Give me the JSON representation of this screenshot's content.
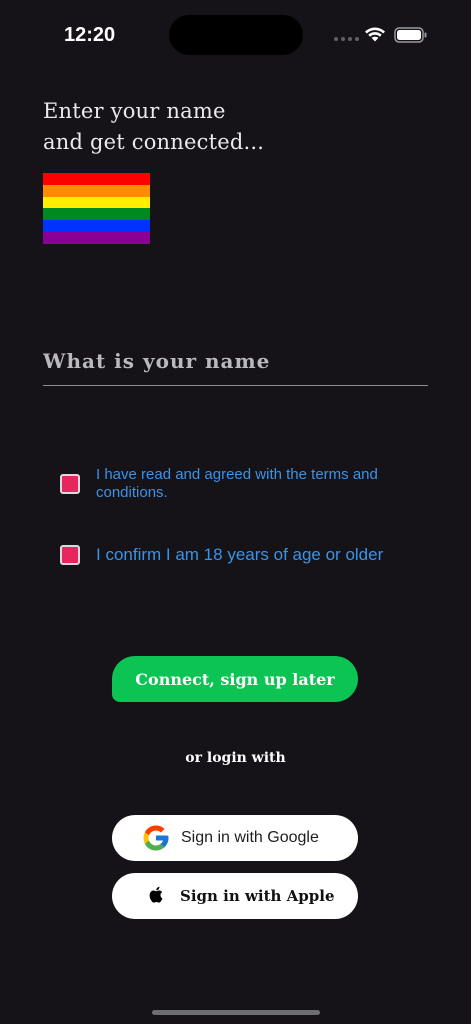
{
  "status_bar": {
    "time": "12:20"
  },
  "header": {
    "line1": "Enter your name",
    "line2": "and get connected..."
  },
  "flag": {
    "icon": "rainbow-flag-icon",
    "stripes": [
      "#ff0000",
      "#ff8c00",
      "#ffee00",
      "#00891f",
      "#0033ff",
      "#8a0096"
    ]
  },
  "name_input": {
    "placeholder": "What is your name",
    "value": ""
  },
  "checkboxes": [
    {
      "label": "I have read and agreed with the terms and conditions.",
      "checked": false,
      "color": "#e6275f"
    },
    {
      "label": "I confirm I am 18 years of age or older",
      "checked": false,
      "color": "#e6275f"
    }
  ],
  "connect_button": {
    "label": "Connect, sign up later",
    "color": "#0bc454"
  },
  "divider_text": "or login with",
  "google_button": {
    "label": "Sign in with Google",
    "icon": "google-icon"
  },
  "apple_button": {
    "label": "Sign in with Apple",
    "icon": "apple-icon"
  },
  "colors": {
    "background": "#151218",
    "link_blue": "#3b93e6"
  }
}
